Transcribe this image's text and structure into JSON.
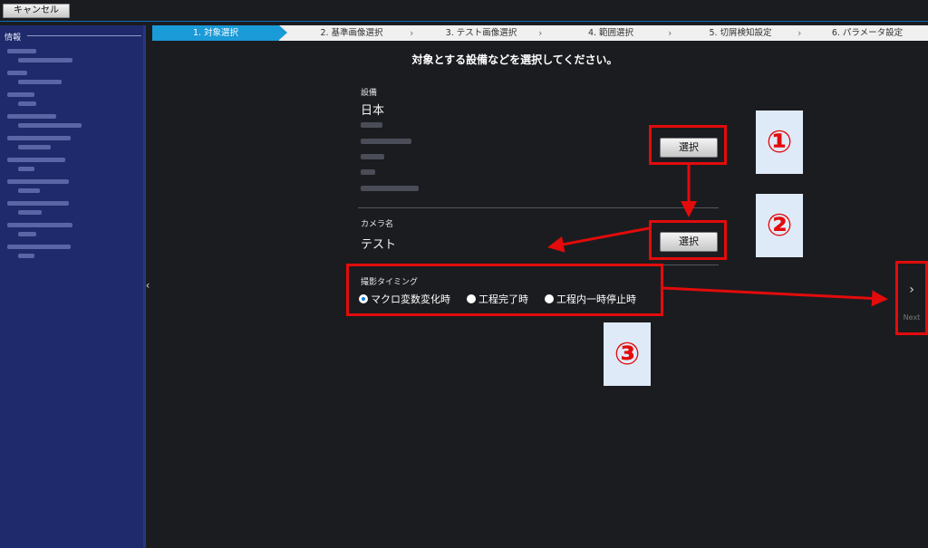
{
  "topbar": {
    "cancel_label": "キャンセル"
  },
  "sidebar": {
    "title": "情報",
    "collapse_icon": "‹"
  },
  "steps": [
    {
      "label": "1. 対象選択"
    },
    {
      "label": "2. 基準画像選択"
    },
    {
      "label": "3. テスト画像選択"
    },
    {
      "label": "4. 範囲選択"
    },
    {
      "label": "5. 切屑検知設定"
    },
    {
      "label": "6. パラメータ設定"
    }
  ],
  "main": {
    "instruction": "対象とする設備などを選択してください。",
    "equipment": {
      "label": "設備",
      "country": "日本",
      "select_label": "選択"
    },
    "camera": {
      "label": "カメラ名",
      "value": "テスト",
      "select_label": "選択"
    },
    "timing": {
      "label": "撮影タイミング",
      "options": [
        "マクロ変数変化時",
        "工程完了時",
        "工程内一時停止時"
      ],
      "selected": 0
    }
  },
  "next": {
    "icon": "chevron-right-icon",
    "label": "Next"
  },
  "annotations": [
    "①",
    "②",
    "③"
  ],
  "colors": {
    "accent": "#1a9ad6",
    "annotation": "#e30b0b",
    "sidebar": "#1e2a6b"
  }
}
